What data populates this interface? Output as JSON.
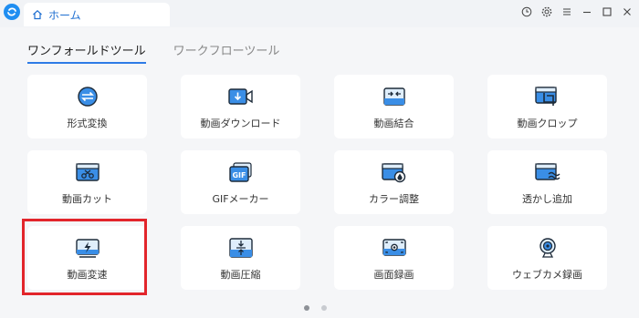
{
  "titlebar": {
    "home_tab_label": "ホーム",
    "controls": [
      "history-icon",
      "settings-icon",
      "menu-icon",
      "minimize-icon",
      "maximize-icon",
      "close-icon"
    ]
  },
  "tabs": [
    {
      "label": "ワンフォールドツール",
      "active": true
    },
    {
      "label": "ワークフローツール",
      "active": false
    }
  ],
  "tools": [
    {
      "label": "形式変換",
      "icon": "convert-icon"
    },
    {
      "label": "動画ダウンロード",
      "icon": "download-icon"
    },
    {
      "label": "動画結合",
      "icon": "merge-icon"
    },
    {
      "label": "動画クロップ",
      "icon": "crop-icon"
    },
    {
      "label": "動画カット",
      "icon": "cut-icon"
    },
    {
      "label": "GIFメーカー",
      "icon": "gif-icon"
    },
    {
      "label": "カラー調整",
      "icon": "color-adjust-icon"
    },
    {
      "label": "透かし追加",
      "icon": "watermark-icon"
    },
    {
      "label": "動画変速",
      "icon": "speed-icon"
    },
    {
      "label": "動画圧縮",
      "icon": "compress-icon"
    },
    {
      "label": "画面録画",
      "icon": "screen-record-icon"
    },
    {
      "label": "ウェブカメ録画",
      "icon": "webcam-icon"
    }
  ],
  "highlighted_tool": "動画変速",
  "pager": {
    "pages": 2,
    "current": 1
  },
  "colors": {
    "accent": "#2e7be6",
    "highlight": "#e2252b",
    "icon_blue": "#3a8ee6"
  }
}
